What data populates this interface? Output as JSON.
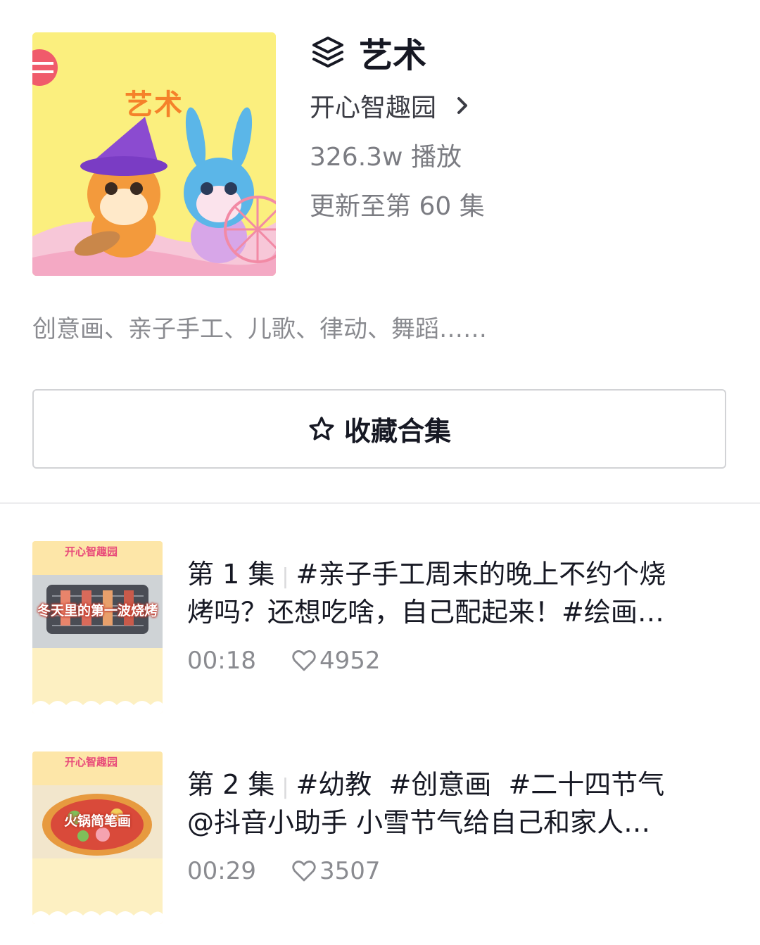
{
  "collection": {
    "cover_label": "艺术",
    "title": "艺术",
    "creator": "开心智趣园",
    "plays": "326.3w 播放",
    "update_status": "更新至第 60 集",
    "description": "创意画、亲子手工、儿歌、律动、舞蹈……",
    "favorite_label": "收藏合集"
  },
  "icons": {
    "collection": "layers-icon",
    "creator_link": "chevron-right-icon",
    "favorite": "star-outline-icon",
    "likes": "heart-outline-icon"
  },
  "colors": {
    "cover_bg": "#fbef7e",
    "accent_orange": "#f5822a",
    "secondary_text": "#7b7c82",
    "border": "#d2d3d6"
  },
  "episodes": [
    {
      "number": "第 1 集",
      "line1": "#亲子手工周末的晚上不约个烧",
      "line2": "烤吗？还想吃啥，自己配起来！#绘画…",
      "duration": "00:18",
      "likes": "4952",
      "thumb_brand": "开心智趣园",
      "thumb_caption": "冬天里的第一波烧烤"
    },
    {
      "number": "第 2 集",
      "line1": "#幼教  #创意画  #二十四节气",
      "line2": "@抖音小助手 小雪节气给自己和家人…",
      "duration": "00:29",
      "likes": "3507",
      "thumb_brand": "开心智趣园",
      "thumb_caption": "火锅简笔画"
    }
  ]
}
